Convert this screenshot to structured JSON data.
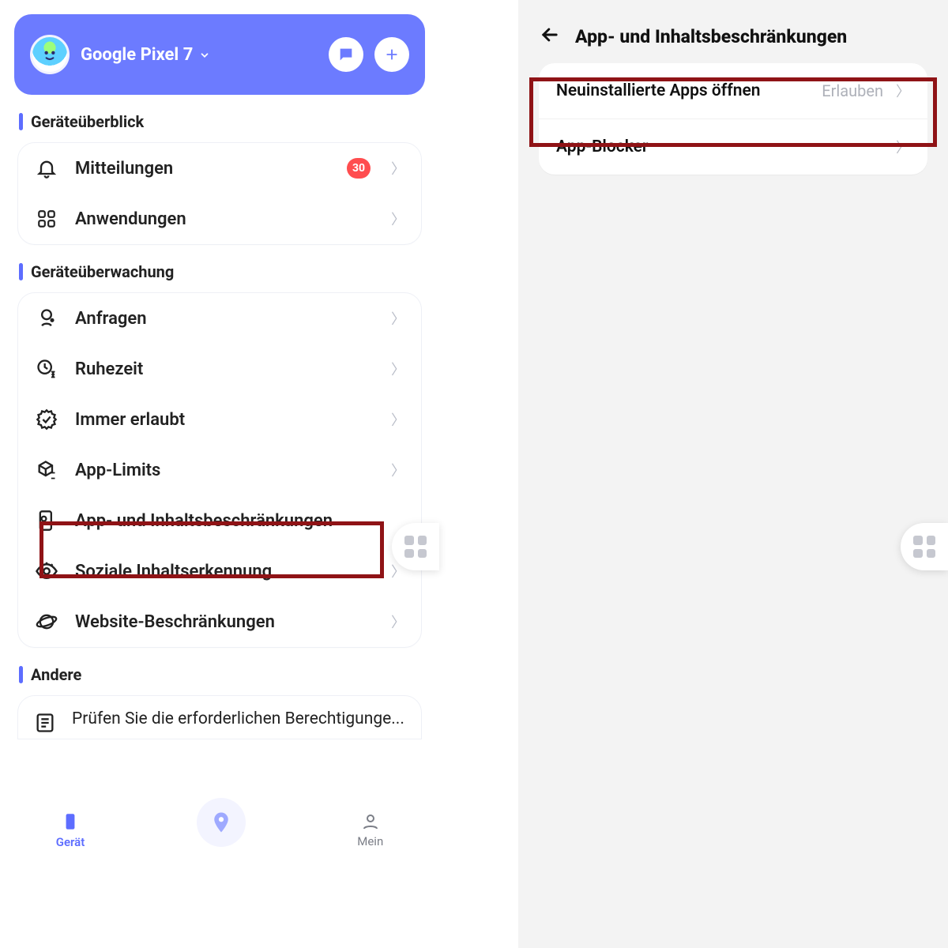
{
  "left": {
    "header": {
      "device_name": "Google Pixel 7"
    },
    "sections": {
      "overview": {
        "title": "Geräteüberblick",
        "items": {
          "notifications": {
            "label": "Mitteilungen",
            "badge": "30"
          },
          "applications": {
            "label": "Anwendungen"
          }
        }
      },
      "monitoring": {
        "title": "Geräteüberwachung",
        "items": {
          "requests": {
            "label": "Anfragen"
          },
          "downtime": {
            "label": "Ruhezeit"
          },
          "always_allowed": {
            "label": "Immer erlaubt"
          },
          "app_limits": {
            "label": "App-Limits"
          },
          "content_restrictions": {
            "label": "App- und Inhaltsbeschränkungen"
          },
          "social_detection": {
            "label": "Soziale Inhaltserkennung"
          },
          "website_restrictions": {
            "label": "Website-Beschränkungen"
          }
        }
      },
      "other": {
        "title": "Andere",
        "items": {
          "check_permissions": {
            "label": "Prüfen Sie die erforderlichen Berechtigunge..."
          }
        }
      }
    },
    "bottom_nav": {
      "device": "Gerät",
      "mine": "Mein"
    }
  },
  "right": {
    "title": "App- und Inhaltsbeschränkungen",
    "rows": {
      "newly_installed": {
        "label": "Neuinstallierte Apps öffnen",
        "value": "Erlauben"
      },
      "app_blocker": {
        "label": "App-Blocker"
      }
    }
  }
}
